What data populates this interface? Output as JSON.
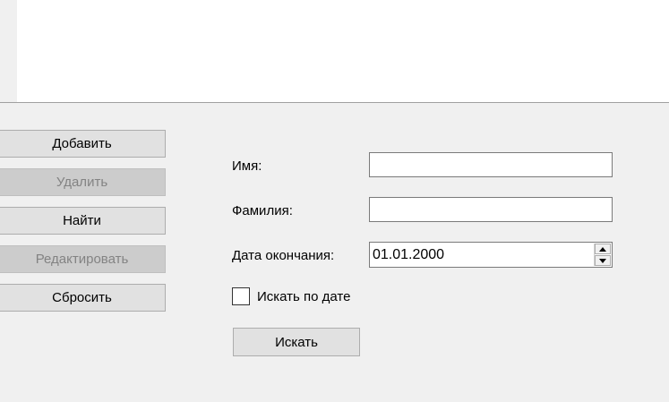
{
  "actions": {
    "add_label": "Добавить",
    "delete_label": "Удалить",
    "find_label": "Найти",
    "edit_label": "Редактировать",
    "reset_label": "Сбросить"
  },
  "form": {
    "first_name_label": "Имя:",
    "first_name_value": "",
    "last_name_label": "Фамилия:",
    "last_name_value": "",
    "end_date_label": "Дата окончания:",
    "end_date_value": "01.01.2000",
    "search_by_date_label": "Искать по дате",
    "search_by_date_checked": false,
    "search_button_label": "Искать"
  },
  "colors": {
    "window_bg": "#f0f0f0",
    "button_bg": "#e1e1e1",
    "disabled_button_bg": "#cccccc",
    "disabled_text": "#838383"
  }
}
